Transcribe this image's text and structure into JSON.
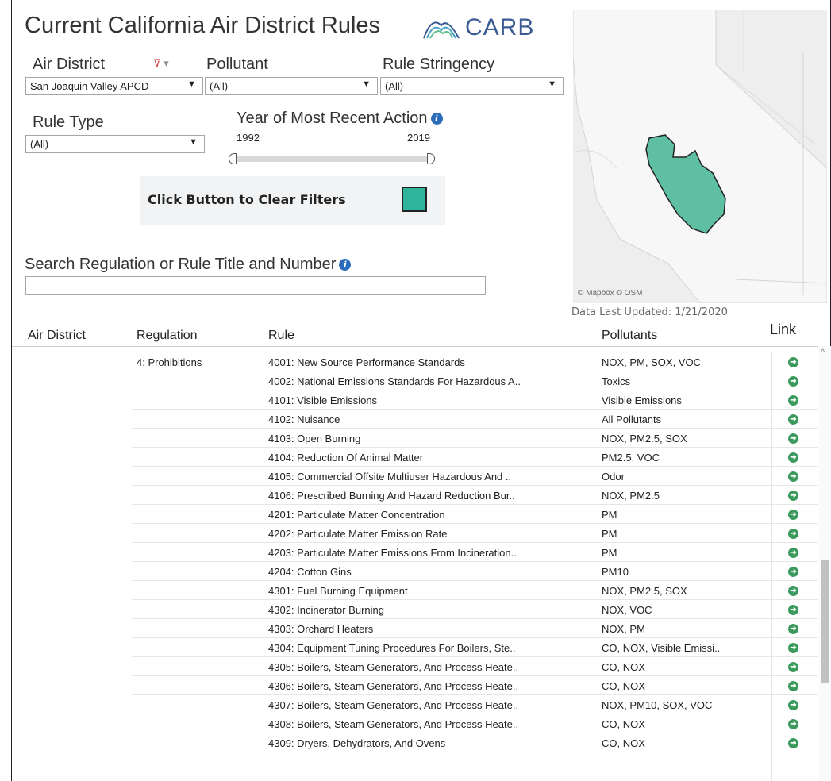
{
  "title": "Current California Air District Rules",
  "logo": {
    "text": "CARB",
    "icon": "carb-arc-logo-icon",
    "color": "#3a5a94"
  },
  "filters": {
    "air_district": {
      "label": "Air District",
      "value": "San Joaquin Valley APCD"
    },
    "pollutant": {
      "label": "Pollutant",
      "value": "(All)"
    },
    "rule_stringency": {
      "label": "Rule Stringency",
      "value": "(All)"
    },
    "rule_type": {
      "label": "Rule Type",
      "value": "(All)"
    },
    "year": {
      "label": "Year of Most Recent Action",
      "min": "1992",
      "max": "2019"
    }
  },
  "clear_filters": {
    "label": "Click Button to Clear Filters",
    "color": "#2fb59e"
  },
  "search": {
    "label": "Search Regulation or Rule Title and Number",
    "value": ""
  },
  "map": {
    "credit": "© Mapbox © OSM",
    "highlight_color": "#5fbfa3"
  },
  "data_updated": "Data Last Updated: 1/21/2020",
  "table": {
    "headers": {
      "district": "Air District",
      "regulation": "Regulation",
      "rule": "Rule",
      "pollutants": "Pollutants",
      "link": "Link"
    },
    "rows": [
      {
        "regulation": "4: Prohibitions",
        "rule": "4001: New Source Performance Standards",
        "pollutants": "NOX, PM, SOX, VOC"
      },
      {
        "regulation": "",
        "rule": "4002: National Emissions Standards For Hazardous A..",
        "pollutants": "Toxics"
      },
      {
        "regulation": "",
        "rule": "4101: Visible Emissions",
        "pollutants": "Visible Emissions"
      },
      {
        "regulation": "",
        "rule": "4102: Nuisance",
        "pollutants": "All Pollutants"
      },
      {
        "regulation": "",
        "rule": "4103: Open Burning",
        "pollutants": "NOX, PM2.5, SOX"
      },
      {
        "regulation": "",
        "rule": "4104: Reduction Of Animal Matter",
        "pollutants": "PM2.5, VOC"
      },
      {
        "regulation": "",
        "rule": "4105: Commercial Offsite Multiuser Hazardous And ..",
        "pollutants": "Odor"
      },
      {
        "regulation": "",
        "rule": "4106: Prescribed Burning And Hazard Reduction Bur..",
        "pollutants": "NOX, PM2.5"
      },
      {
        "regulation": "",
        "rule": "4201: Particulate Matter Concentration",
        "pollutants": "PM"
      },
      {
        "regulation": "",
        "rule": "4202: Particulate Matter Emission Rate",
        "pollutants": "PM"
      },
      {
        "regulation": "",
        "rule": "4203: Particulate Matter Emissions From Incineration..",
        "pollutants": "PM"
      },
      {
        "regulation": "",
        "rule": "4204: Cotton Gins",
        "pollutants": "PM10"
      },
      {
        "regulation": "",
        "rule": "4301: Fuel Burning Equipment",
        "pollutants": "NOX, PM2.5, SOX"
      },
      {
        "regulation": "",
        "rule": "4302: Incinerator Burning",
        "pollutants": "NOX, VOC"
      },
      {
        "regulation": "",
        "rule": "4303: Orchard Heaters",
        "pollutants": "NOX, PM"
      },
      {
        "regulation": "",
        "rule": "4304: Equipment Tuning Procedures For Boilers, Ste..",
        "pollutants": "CO, NOX, Visible Emissi.."
      },
      {
        "regulation": "",
        "rule": "4305: Boilers, Steam Generators, And Process Heate..",
        "pollutants": "CO, NOX"
      },
      {
        "regulation": "",
        "rule": "4306: Boilers, Steam Generators, And Process Heate..",
        "pollutants": "CO, NOX"
      },
      {
        "regulation": "",
        "rule": "4307: Boilers, Steam Generators, And Process Heate..",
        "pollutants": "NOX, PM10, SOX, VOC"
      },
      {
        "regulation": "",
        "rule": "4308: Boilers, Steam Generators, And Process Heate..",
        "pollutants": "CO, NOX"
      },
      {
        "regulation": "",
        "rule": "4309: Dryers, Dehydrators, And Ovens",
        "pollutants": "CO, NOX"
      }
    ]
  }
}
